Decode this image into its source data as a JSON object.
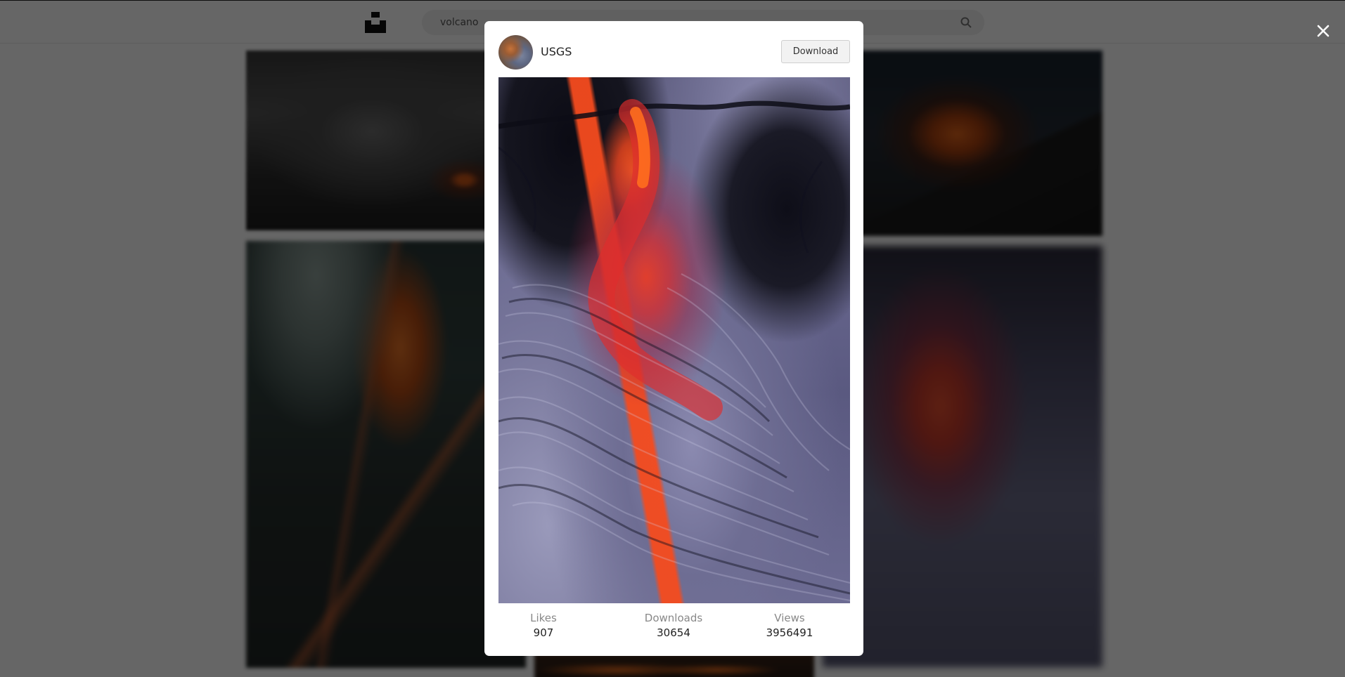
{
  "search": {
    "value": "volcano"
  },
  "modal": {
    "author": "USGS",
    "download_label": "Download",
    "stats": {
      "likes_label": "Likes",
      "likes_value": "907",
      "downloads_label": "Downloads",
      "downloads_value": "30654",
      "views_label": "Views",
      "views_value": "3956491"
    }
  },
  "icons": {
    "close": "close-icon",
    "logo": "camera-logo-icon",
    "search": "search-icon"
  }
}
